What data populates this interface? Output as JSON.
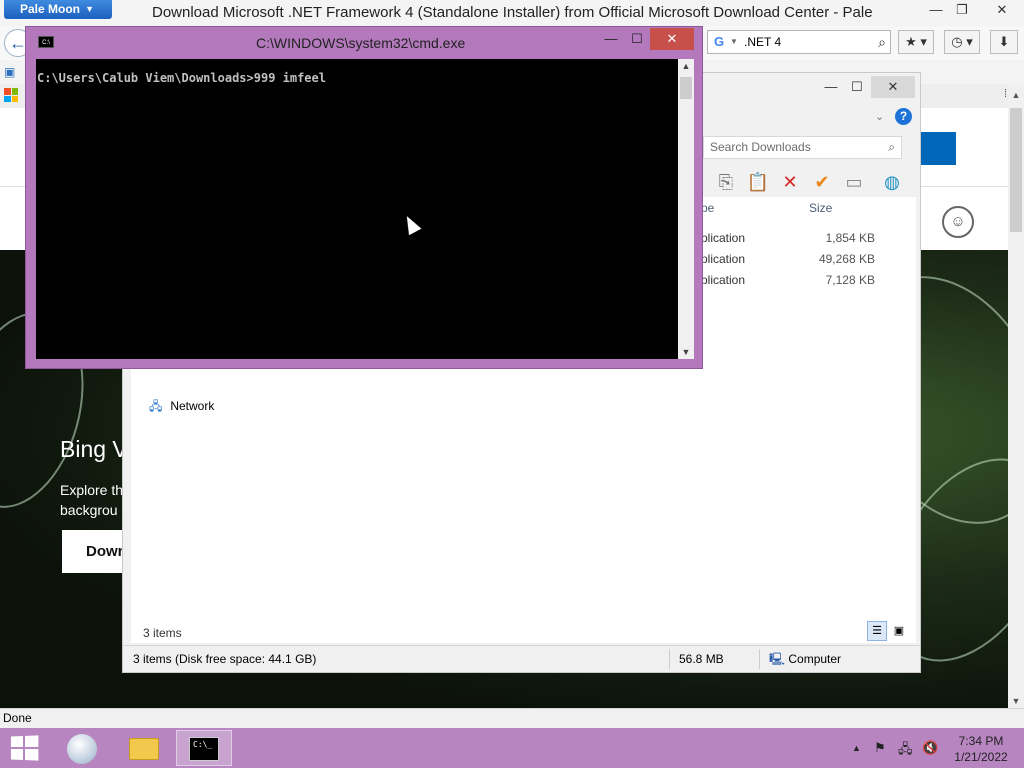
{
  "browser": {
    "app_menu_label": "Pale Moon",
    "window_title": "Download Microsoft .NET Framework 4 (Standalone Installer) from Official Microsoft Download Center - Pale",
    "search": {
      "value": ".NET 4",
      "engine_icon": "google-icon"
    },
    "status_text": "Done"
  },
  "webpage": {
    "hero_title": "Bing V",
    "hero_text_line1": "Explore th",
    "hero_text_line2": "backgrou",
    "hero_button_label": "Down"
  },
  "explorer": {
    "search_placeholder": "Search Downloads",
    "columns": {
      "type": "pe",
      "size": "Size"
    },
    "files": [
      {
        "type": "plication",
        "size": "1,854 KB"
      },
      {
        "type": "plication",
        "size": "49,268 KB"
      },
      {
        "type": "plication",
        "size": "7,128 KB"
      }
    ],
    "nav_network_label": "Network",
    "item_count": "3 items",
    "status": {
      "items_free": "3 items (Disk free space: 44.1 GB)",
      "size_total": "56.8 MB",
      "location": "Computer"
    }
  },
  "cmd": {
    "title": "C:\\WINDOWS\\system32\\cmd.exe",
    "prompt_line": "C:\\Users\\Calub Viem\\Downloads>999 imfeel"
  },
  "taskbar": {
    "clock_time": "7:34 PM",
    "clock_date": "1/21/2022"
  }
}
